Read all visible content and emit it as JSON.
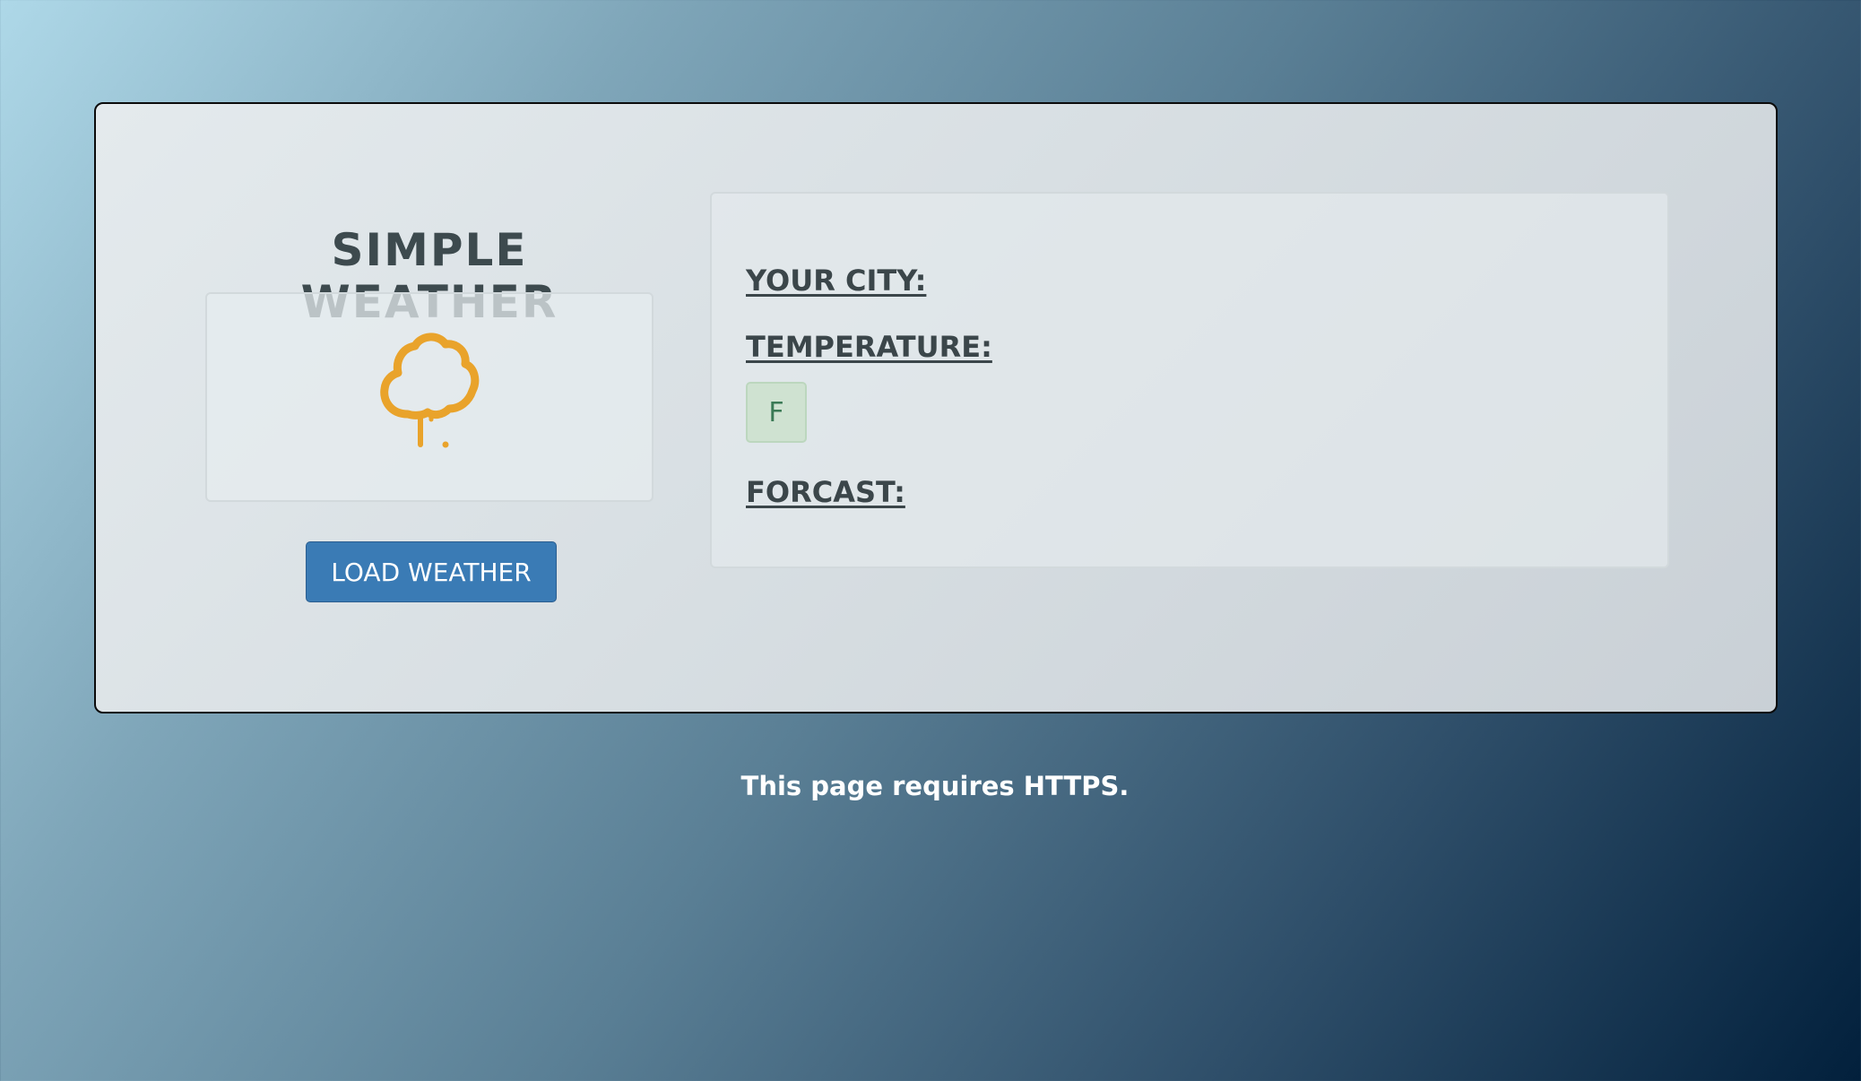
{
  "app": {
    "title": "SIMPLE WEATHER"
  },
  "icon": {
    "name": "weather-cloud-drip-icon",
    "color": "#e9a32b"
  },
  "actions": {
    "load_label": "LOAD WEATHER"
  },
  "info": {
    "city_label": "YOUR CITY:",
    "temperature_label": "TEMPERATURE:",
    "unit_toggle_label": "F",
    "forecast_label": "FORCAST:"
  },
  "footer": {
    "note": "This page requires HTTPS."
  },
  "colors": {
    "button": "#3a7bb5",
    "unit_toggle": "#cfe2d1",
    "heading": "#3d4a4e"
  }
}
